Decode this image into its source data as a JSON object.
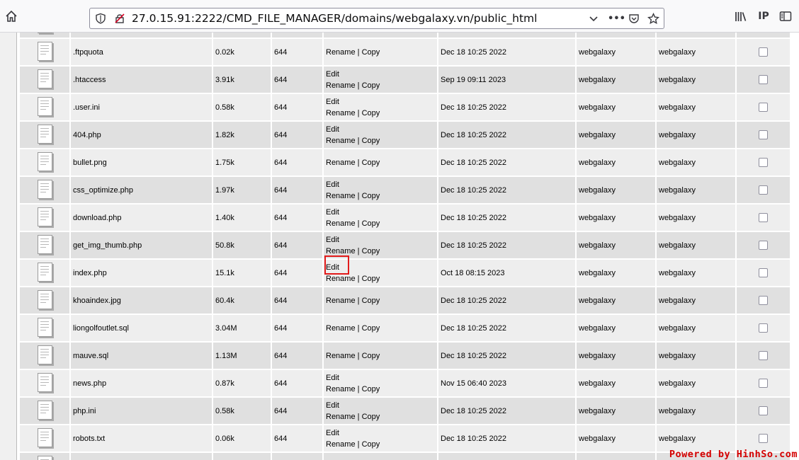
{
  "browser": {
    "url": "27.0.15.91:2222/CMD_FILE_MANAGER/domains/webgalaxy.vn/public_html",
    "home_icon": "home-icon",
    "shield_icon": "shield-icon",
    "insecure_icon": "insecure-lock-icon"
  },
  "table": {
    "rename_label": "Rename",
    "copy_label": "Copy",
    "separator": " | ",
    "edit_label": "Edit",
    "rows": [
      {
        "name": "",
        "size": "",
        "perm": "",
        "edit": true,
        "date": "",
        "owner": "",
        "group": ""
      },
      {
        "name": ".ftpquota",
        "size": "0.02k",
        "perm": "644",
        "edit": false,
        "date": "Dec 18 10:25 2022",
        "owner": "webgalaxy",
        "group": "webgalaxy"
      },
      {
        "name": ".htaccess",
        "size": "3.91k",
        "perm": "644",
        "edit": true,
        "date": "Sep 19 09:11 2023",
        "owner": "webgalaxy",
        "group": "webgalaxy"
      },
      {
        "name": ".user.ini",
        "size": "0.58k",
        "perm": "644",
        "edit": true,
        "date": "Dec 18 10:25 2022",
        "owner": "webgalaxy",
        "group": "webgalaxy"
      },
      {
        "name": "404.php",
        "size": "1.82k",
        "perm": "644",
        "edit": true,
        "date": "Dec 18 10:25 2022",
        "owner": "webgalaxy",
        "group": "webgalaxy"
      },
      {
        "name": "bullet.png",
        "size": "1.75k",
        "perm": "644",
        "edit": false,
        "date": "Dec 18 10:25 2022",
        "owner": "webgalaxy",
        "group": "webgalaxy"
      },
      {
        "name": "css_optimize.php",
        "size": "1.97k",
        "perm": "644",
        "edit": true,
        "date": "Dec 18 10:25 2022",
        "owner": "webgalaxy",
        "group": "webgalaxy"
      },
      {
        "name": "download.php",
        "size": "1.40k",
        "perm": "644",
        "edit": true,
        "date": "Dec 18 10:25 2022",
        "owner": "webgalaxy",
        "group": "webgalaxy"
      },
      {
        "name": "get_img_thumb.php",
        "size": "50.8k",
        "perm": "644",
        "edit": true,
        "date": "Dec 18 10:25 2022",
        "owner": "webgalaxy",
        "group": "webgalaxy"
      },
      {
        "name": "index.php",
        "size": "15.1k",
        "perm": "644",
        "edit": true,
        "date": "Oct 18 08:15 2023",
        "owner": "webgalaxy",
        "group": "webgalaxy"
      },
      {
        "name": "khoaindex.jpg",
        "size": "60.4k",
        "perm": "644",
        "edit": false,
        "date": "Dec 18 10:25 2022",
        "owner": "webgalaxy",
        "group": "webgalaxy"
      },
      {
        "name": "liongolfoutlet.sql",
        "size": "3.04M",
        "perm": "644",
        "edit": false,
        "date": "Dec 18 10:25 2022",
        "owner": "webgalaxy",
        "group": "webgalaxy"
      },
      {
        "name": "mauve.sql",
        "size": "1.13M",
        "perm": "644",
        "edit": false,
        "date": "Dec 18 10:25 2022",
        "owner": "webgalaxy",
        "group": "webgalaxy"
      },
      {
        "name": "news.php",
        "size": "0.87k",
        "perm": "644",
        "edit": true,
        "date": "Nov 15 06:40 2023",
        "owner": "webgalaxy",
        "group": "webgalaxy"
      },
      {
        "name": "php.ini",
        "size": "0.58k",
        "perm": "644",
        "edit": true,
        "date": "Dec 18 10:25 2022",
        "owner": "webgalaxy",
        "group": "webgalaxy"
      },
      {
        "name": "robots.txt",
        "size": "0.06k",
        "perm": "644",
        "edit": true,
        "date": "Dec 18 10:25 2022",
        "owner": "webgalaxy",
        "group": "webgalaxy"
      },
      {
        "name": "",
        "size": "",
        "perm": "",
        "edit": true,
        "date": "",
        "owner": "",
        "group": ""
      }
    ]
  },
  "watermark": "Powered by HinhSo.com",
  "colors": {
    "highlight": "#e21a1a",
    "row_odd": "#eeeeee",
    "row_even": "#e0e0e0"
  }
}
